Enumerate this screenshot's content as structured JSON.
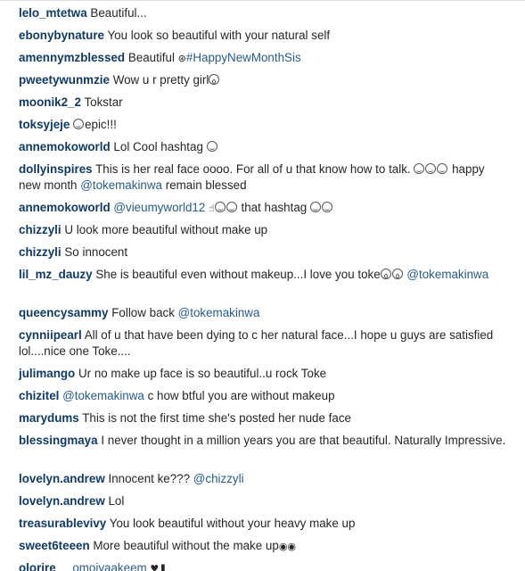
{
  "comments": [
    {
      "user": "lelo_mtetwa",
      "text": "Beautiful..."
    },
    {
      "user": "ebonybynature",
      "text": "You look so beautiful with your natural self"
    },
    {
      "user": "amennymzblessed",
      "text": "Beautiful",
      "hashtag": "#HappyNewMonthSis"
    },
    {
      "user": "pweetywunmzie",
      "text": "Wow u r pretty girl"
    },
    {
      "user": "moonik2_2",
      "text": "Tokstar"
    },
    {
      "user": "toksyjeje",
      "text": "epic!!!"
    },
    {
      "user": "annemokoworld",
      "text": "Lol Cool hashtag"
    },
    {
      "user": "dollyinspires",
      "text": "This is her real face oooo. For all of u that know how to talk.",
      "text2": "happy new month",
      "mention": "@tokemakinwa",
      "text3": "remain blessed"
    },
    {
      "user": "annemokoworld",
      "mention": "@vieumyworld12",
      "text": "that hashtag"
    },
    {
      "user": "chizzyli",
      "text": "U look more beautiful without make up"
    },
    {
      "user": "chizzyli",
      "text": "So innocent"
    },
    {
      "user": "lil_mz_dauzy",
      "text": "She is beautiful even without makeup...I love you toke",
      "mention": "@tokemakinwa"
    },
    {
      "user": "queencysammy",
      "text": "Follow back",
      "mention": "@tokemakinwa"
    },
    {
      "user": "cynniipearl",
      "text": "All of u that have been dying to c her natural face...I hope u guys are satisfied lol....nice one Toke...."
    },
    {
      "user": "julimango",
      "text": "Ur no make up face is so beautiful..u rock Toke"
    },
    {
      "user": "chizitel",
      "mention": "@tokemakinwa",
      "text": "c how btful you are without makeup"
    },
    {
      "user": "marydums",
      "text": "This is not the first time she's posted her nude face"
    },
    {
      "user": "blessingmaya",
      "text": "I never thought in a million years you are that beautiful. Naturally Impressive."
    },
    {
      "user": "lovelyn.andrew",
      "text": "Innocent ke???",
      "mention": "@chizzyli"
    },
    {
      "user": "lovelyn.andrew",
      "text": "Lol"
    },
    {
      "user": "treasurablevivy",
      "text": "You look beautiful without your heavy make up"
    },
    {
      "user": "sweet6teeen",
      "text": "More beautiful without the make up"
    },
    {
      "user": "olorire__",
      "text": "omoiyaakeem"
    }
  ],
  "icons": [
    "smiley-icon",
    "surprised-face-icon",
    "eyes-icon",
    "hand-icon",
    "heart-icon",
    "lips-icon"
  ]
}
